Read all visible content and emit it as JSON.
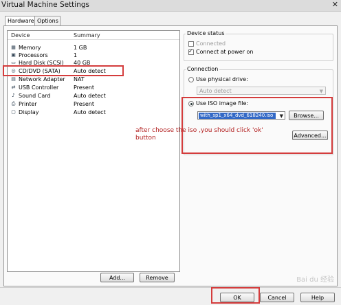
{
  "window": {
    "title": "Virtual Machine Settings"
  },
  "tabs": [
    {
      "label": "Hardware"
    },
    {
      "label": "Options"
    }
  ],
  "device_list": {
    "columns": {
      "device": "Device",
      "summary": "Summary"
    },
    "rows": [
      {
        "icon": "memory-icon",
        "device": "Memory",
        "summary": "1 GB"
      },
      {
        "icon": "processor-icon",
        "device": "Processors",
        "summary": "1"
      },
      {
        "icon": "hard-disk-icon",
        "device": "Hard Disk (SCSI)",
        "summary": "40 GB"
      },
      {
        "icon": "cd-dvd-icon",
        "device": "CD/DVD (SATA)",
        "summary": "Auto detect"
      },
      {
        "icon": "network-adapter-icon",
        "device": "Network Adapter",
        "summary": "NAT"
      },
      {
        "icon": "usb-controller-icon",
        "device": "USB Controller",
        "summary": "Present"
      },
      {
        "icon": "sound-card-icon",
        "device": "Sound Card",
        "summary": "Auto detect"
      },
      {
        "icon": "printer-icon",
        "device": "Printer",
        "summary": "Present"
      },
      {
        "icon": "display-icon",
        "device": "Display",
        "summary": "Auto detect"
      }
    ],
    "add_button": "Add...",
    "remove_button": "Remove"
  },
  "device_status": {
    "title": "Device status",
    "connected": {
      "label": "Connected",
      "checked": false,
      "enabled": false
    },
    "connect_at_power_on": {
      "label": "Connect at power on",
      "checked": true
    }
  },
  "connection": {
    "title": "Connection",
    "use_physical_drive": {
      "label": "Use physical drive:",
      "selected": false
    },
    "physical_drive_value": "Auto detect",
    "use_iso": {
      "label": "Use ISO image file:",
      "selected": true
    },
    "iso_value": "with_sp1_x64_dvd_618240.iso",
    "browse_button": "Browse...",
    "advanced_button": "Advanced..."
  },
  "annotation": {
    "text": "after choose the iso ,you should click 'ok' button",
    "color": "#b21e1e"
  },
  "footer": {
    "ok": "OK",
    "cancel": "Cancel",
    "help": "Help"
  },
  "watermark": "Bai du 经验"
}
